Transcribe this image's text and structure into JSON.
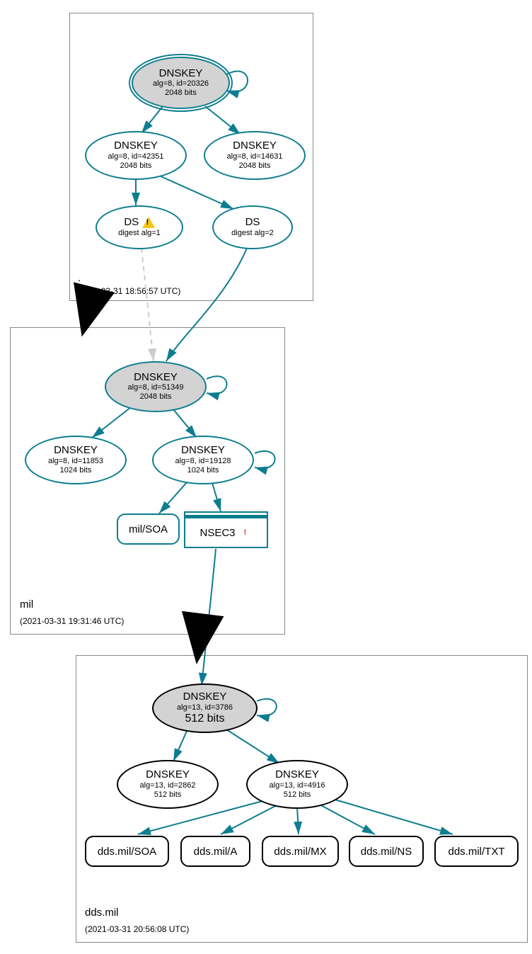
{
  "zones": {
    "root": {
      "label": ".",
      "timestamp": "(2021-03-31 18:56:57 UTC)"
    },
    "mil": {
      "label": "mil",
      "timestamp": "(2021-03-31 19:31:46 UTC)"
    },
    "dds": {
      "label": "dds.mil",
      "timestamp": "(2021-03-31 20:56:08 UTC)"
    }
  },
  "nodes": {
    "root_ksk": {
      "title": "DNSKEY",
      "sub1": "alg=8, id=20326",
      "sub2": "2048 bits"
    },
    "root_zsk1": {
      "title": "DNSKEY",
      "sub1": "alg=8, id=42351",
      "sub2": "2048 bits"
    },
    "root_zsk2": {
      "title": "DNSKEY",
      "sub1": "alg=8, id=14631",
      "sub2": "2048 bits"
    },
    "ds1": {
      "title": "DS",
      "sub1": "digest alg=1"
    },
    "ds2": {
      "title": "DS",
      "sub1": "digest alg=2"
    },
    "mil_ksk": {
      "title": "DNSKEY",
      "sub1": "alg=8, id=51349",
      "sub2": "2048 bits"
    },
    "mil_zsk1": {
      "title": "DNSKEY",
      "sub1": "alg=8, id=11853",
      "sub2": "1024 bits"
    },
    "mil_zsk2": {
      "title": "DNSKEY",
      "sub1": "alg=8, id=19128",
      "sub2": "1024 bits"
    },
    "mil_soa": {
      "label": "mil/SOA"
    },
    "nsec3": {
      "label": "NSEC3"
    },
    "dds_ksk": {
      "title": "DNSKEY",
      "sub1": "alg=13, id=3786",
      "sub2": "512 bits"
    },
    "dds_zsk1": {
      "title": "DNSKEY",
      "sub1": "alg=13, id=2862",
      "sub2": "512 bits"
    },
    "dds_zsk2": {
      "title": "DNSKEY",
      "sub1": "alg=13, id=4916",
      "sub2": "512 bits"
    },
    "dds_soa": {
      "label": "dds.mil/SOA"
    },
    "dds_a": {
      "label": "dds.mil/A"
    },
    "dds_mx": {
      "label": "dds.mil/MX"
    },
    "dds_ns": {
      "label": "dds.mil/NS"
    },
    "dds_txt": {
      "label": "dds.mil/TXT"
    }
  },
  "colors": {
    "edge": "#0d7d8f",
    "edge_dash": "#cccccc",
    "black": "#000000"
  }
}
